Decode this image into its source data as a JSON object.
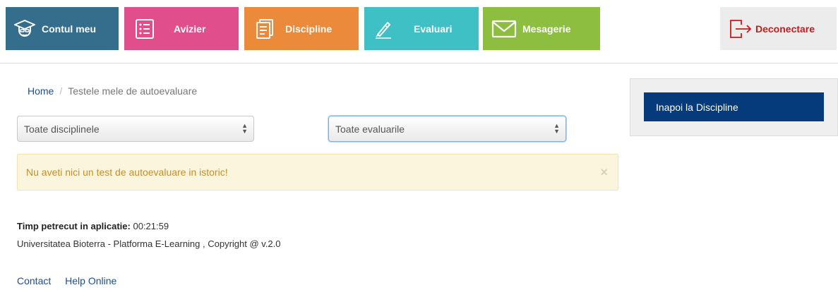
{
  "nav": {
    "account": "Contul meu",
    "board": "Avizier",
    "courses": "Discipline",
    "evaluations": "Evaluari",
    "messages": "Mesagerie",
    "logout": "Deconectare"
  },
  "colors": {
    "account": "#356d8c",
    "board": "#e04f8c",
    "courses": "#ec8a3b",
    "evaluations": "#3ec0c4",
    "messages": "#8dbe3f",
    "logout_text": "#c81b1b",
    "primary_button": "#053a7b"
  },
  "breadcrumb": {
    "home": "Home",
    "separator": "/",
    "current": "Testele mele de autoevaluare"
  },
  "filters": {
    "courses_selected": "Toate disciplinele",
    "evaluations_selected": "Toate evaluarile"
  },
  "alert": {
    "message": "Nu aveti nici un test de autoevaluare in istoric!",
    "close": "×"
  },
  "sidebar": {
    "back_button": "Inapoi la Discipline"
  },
  "footer": {
    "time_label": "Timp petrecut in aplicatie:",
    "time_value": "00:21:59",
    "copyright": "Universitatea Bioterra - Platforma E-Learning , Copyright @ v.2.0",
    "links": [
      "Contact",
      "Help Online"
    ]
  },
  "icons": {
    "account": "graduate-icon",
    "board": "list-icon",
    "courses": "document-icon",
    "evaluations": "pen-icon",
    "messages": "envelope-icon",
    "logout": "logout-icon"
  }
}
